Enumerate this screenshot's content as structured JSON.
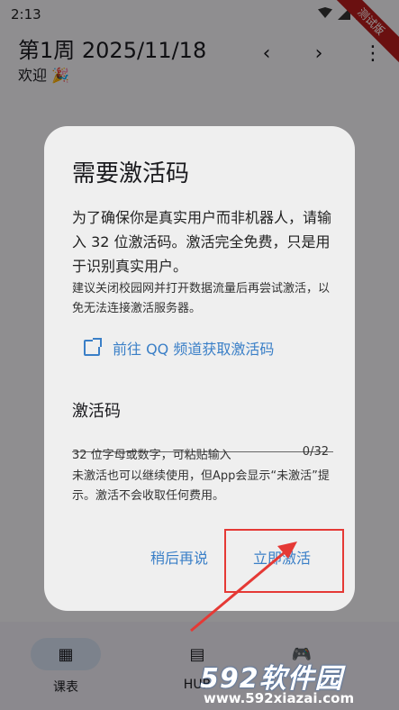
{
  "status_bar": {
    "time": "2:13",
    "debug_label": "测试版"
  },
  "appbar": {
    "title": "第1周 2025/11/18",
    "subtitle": "欢迎 🎉",
    "prev_icon": "chevron-left-icon",
    "next_icon": "chevron-right-icon",
    "more_icon": "more-vert-icon"
  },
  "dialog": {
    "title": "需要激活码",
    "body": "为了确保你是真实用户而非机器人，请输入 32 位激活码。激活完全免费，只是用于识别真实用户。",
    "note": "建议关闭校园网并打开数据流量后再尝试激活，以免无法连接激活服务器。",
    "qq_link": "前往 QQ 频道获取激活码",
    "field_label": "激活码",
    "field_value": "",
    "field_hint": "32 位字母或数字，可粘贴输入",
    "field_counter": "0/32",
    "warning": "未激活也可以继续使用，但App会显示“未激活”提示。激活不会收取任何费用。",
    "later_button": "稍后再说",
    "activate_button": "立即激活"
  },
  "bottom_nav": {
    "items": [
      {
        "label": "课表",
        "icon": "calendar-icon"
      },
      {
        "label": "HUB",
        "icon": "article-icon"
      },
      {
        "label": "",
        "icon": "game-controller-icon"
      }
    ]
  },
  "watermark": {
    "brand": "592软件园",
    "url": "www.592xiazai.com"
  },
  "colors": {
    "accent": "#3a7fc7",
    "annotation": "#e53935"
  }
}
